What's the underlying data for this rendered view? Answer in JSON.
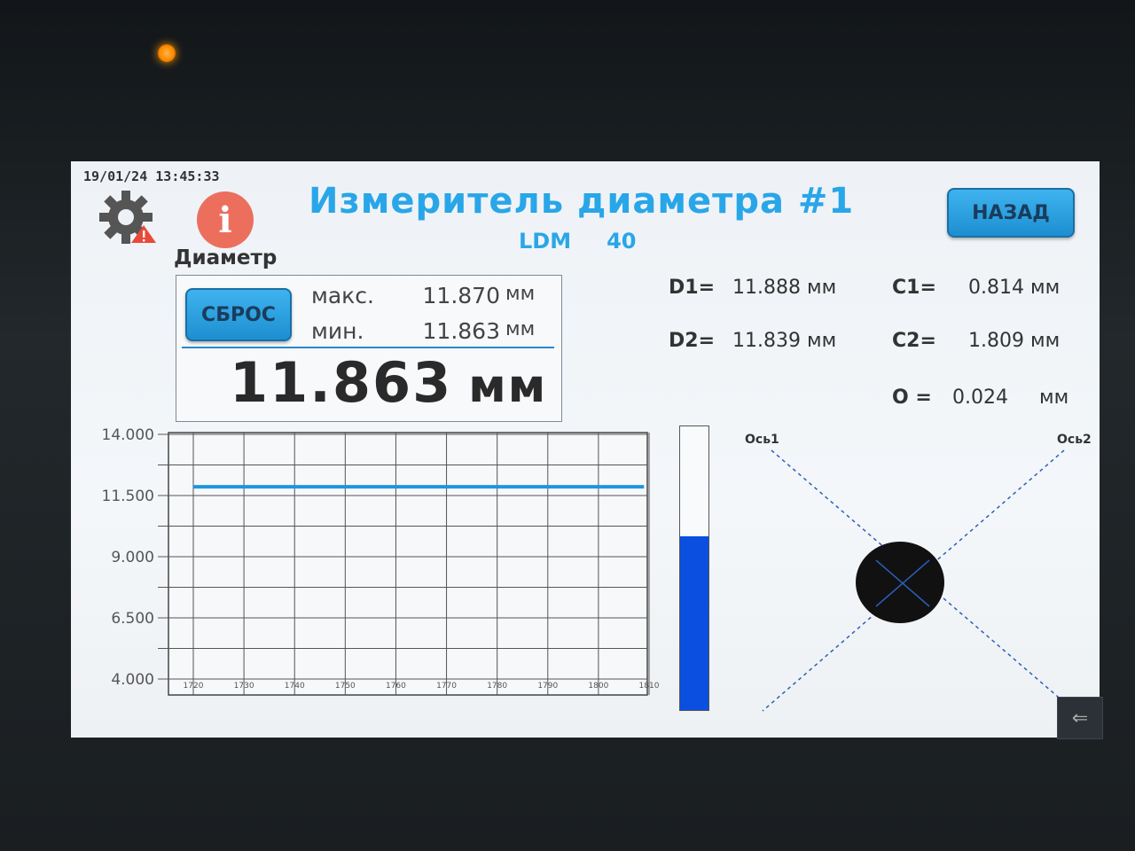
{
  "header": {
    "datetime": "19/01/24 13:45:33",
    "title": "Измеритель диаметра #1",
    "model": "LDM",
    "model_number": "40",
    "back_label": "НАЗАД"
  },
  "icons": {
    "settings": "gear-icon",
    "warning": "warning-icon",
    "info": "info-icon",
    "info_glyph": "i"
  },
  "diameter": {
    "section_label": "Диаметр",
    "reset_label": "СБРОС",
    "max_label": "макс.",
    "max_value": "11.870",
    "min_label": "мин.",
    "min_value": "11.863",
    "unit": "мм",
    "current_value": "11.863",
    "current_unit": "мм"
  },
  "measurements": {
    "d1_label": "D1=",
    "d1_value": "11.888",
    "d2_label": "D2=",
    "d2_value": "11.839",
    "c1_label": "C1=",
    "c1_value": "0.814",
    "c2_label": "C2=",
    "c2_value": "1.809",
    "o_label": "O =",
    "o_value": "0.024",
    "unit": "мм"
  },
  "axes_view": {
    "axis1_label": "Ось1",
    "axis2_label": "Ось2"
  },
  "colors": {
    "accent": "#29a6e8",
    "trend_line": "#1f95e0",
    "level_bar": "#0b4fe0"
  },
  "chart_data": {
    "type": "line",
    "x": [
      1720,
      1730,
      1740,
      1750,
      1760,
      1770,
      1780,
      1790,
      1800,
      1810
    ],
    "x_tick_labels": [
      "1720",
      "1730",
      "1740",
      "1750",
      "1760",
      "1770",
      "1780",
      "1790",
      "1800",
      "1810"
    ],
    "y_tick_labels": [
      "14.000",
      "11.500",
      "9.000",
      "6.500",
      "4.000"
    ],
    "ylim": [
      4.0,
      14.0
    ],
    "xlim": [
      1720,
      1810
    ],
    "grid": true,
    "series": [
      {
        "x": [
          1720,
          1809
        ],
        "values": [
          11.86,
          11.86
        ]
      }
    ],
    "level_bar_value": 11.863
  }
}
